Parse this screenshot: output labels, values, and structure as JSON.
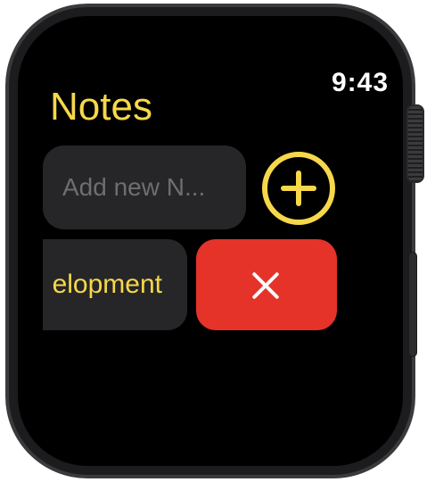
{
  "status_bar": {
    "time": "9:43"
  },
  "header": {
    "title": "Notes"
  },
  "new_note": {
    "placeholder": "Add new N..."
  },
  "notes": [
    {
      "title_visible": "elopment"
    }
  ],
  "icons": {
    "add": "plus-circle-icon",
    "delete": "xmark-icon"
  },
  "colors": {
    "accent": "#f6d84a",
    "destructive": "#e5332a",
    "background": "#000000",
    "field": "#262628"
  }
}
